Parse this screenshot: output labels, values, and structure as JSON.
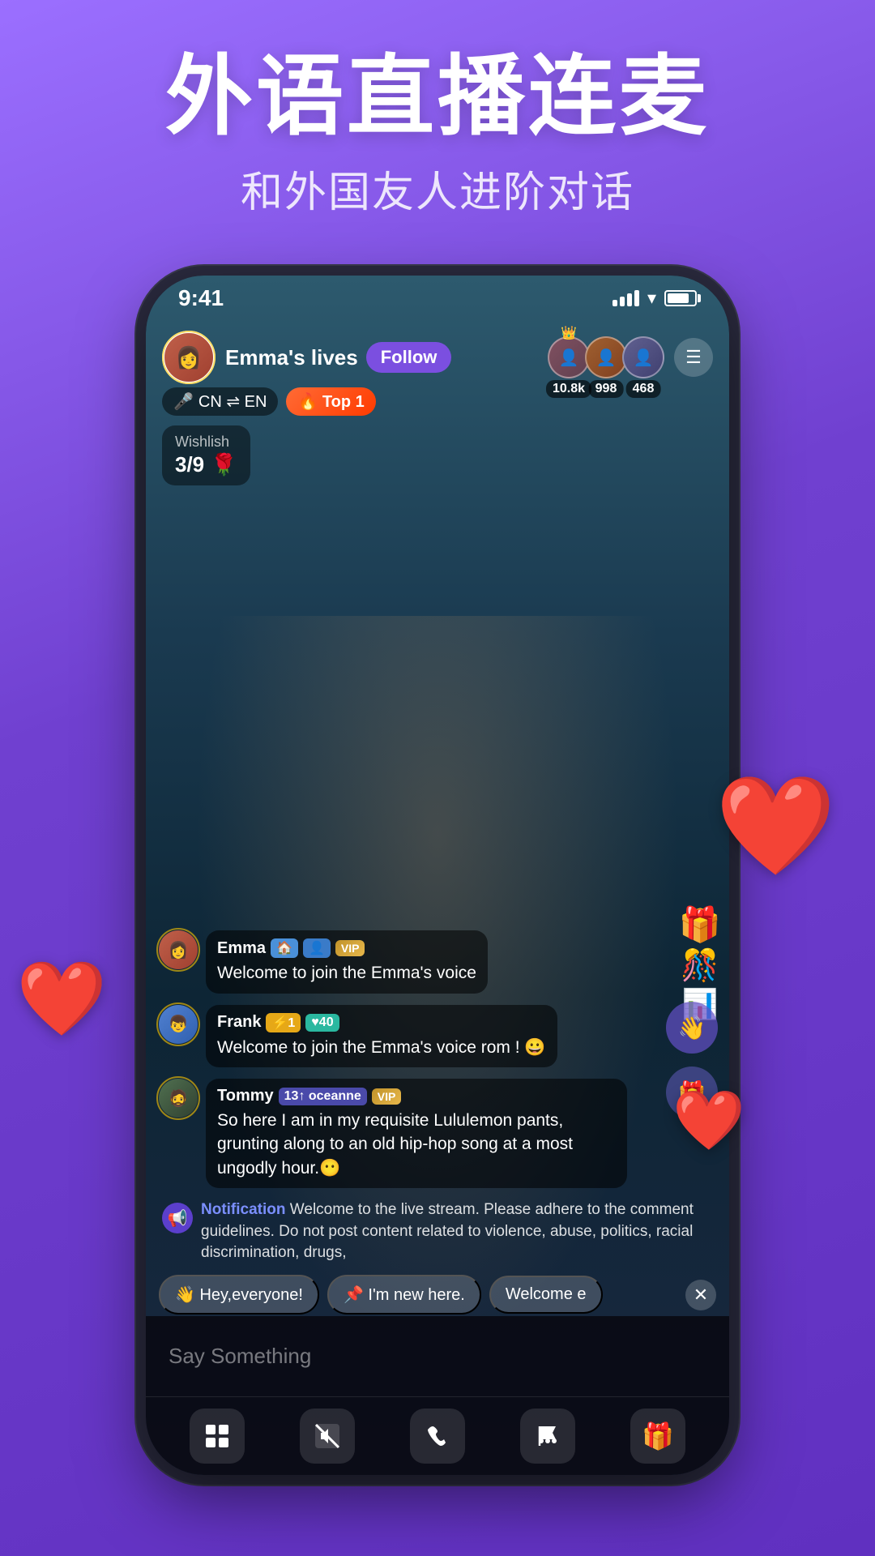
{
  "page": {
    "background_color": "#7B4FE0"
  },
  "hero": {
    "title": "外语直播连麦",
    "subtitle": "和外国友人进阶对话"
  },
  "status_bar": {
    "time": "9:41"
  },
  "stream": {
    "host_name": "Emma's lives",
    "follow_label": "Follow",
    "translation": "CN ⇌ EN",
    "top_tag": "🔥 Top 1",
    "wishlish_label": "Wishlish",
    "wishlish_count": "3/9",
    "wishlish_emoji": "🌹"
  },
  "viewers": [
    {
      "count": "10.8k",
      "color": "#805060"
    },
    {
      "count": "998",
      "color": "#a06030"
    },
    {
      "count": "468",
      "color": "#606090"
    }
  ],
  "comments": [
    {
      "user": "Emma",
      "badges": [
        "🏠",
        "👤",
        "VIP"
      ],
      "text": "Welcome to join the Emma's voice",
      "avatar_class": "av-emma"
    },
    {
      "user": "Frank",
      "badges": [
        "⚡1",
        "♥40"
      ],
      "text": "Welcome to join the Emma's voice rom ! 😀",
      "avatar_class": "av-frank"
    },
    {
      "user": "Tommy",
      "badges": [
        "13↑ oceanne",
        "VIP"
      ],
      "text": "So here I am in my requisite Lululemon pants, grunting along to an old hip-hop song at a most ungodly hour.😶",
      "avatar_class": "av-tommy"
    }
  ],
  "notification": {
    "label": "Notification",
    "text": "Welcome to the live stream. Please adhere to the comment guidelines. Do not post content related to violence, abuse, politics, racial discrimination, drugs,"
  },
  "quick_replies": [
    {
      "emoji": "👋",
      "text": "Hey,everyone!"
    },
    {
      "emoji": "📌",
      "text": "I'm new here."
    },
    {
      "text": "Welcome e"
    }
  ],
  "bottom_bar": {
    "input_placeholder": "Say Something",
    "icons": [
      "⊞",
      "🔇",
      "📞",
      "⚑",
      "🎁"
    ]
  }
}
